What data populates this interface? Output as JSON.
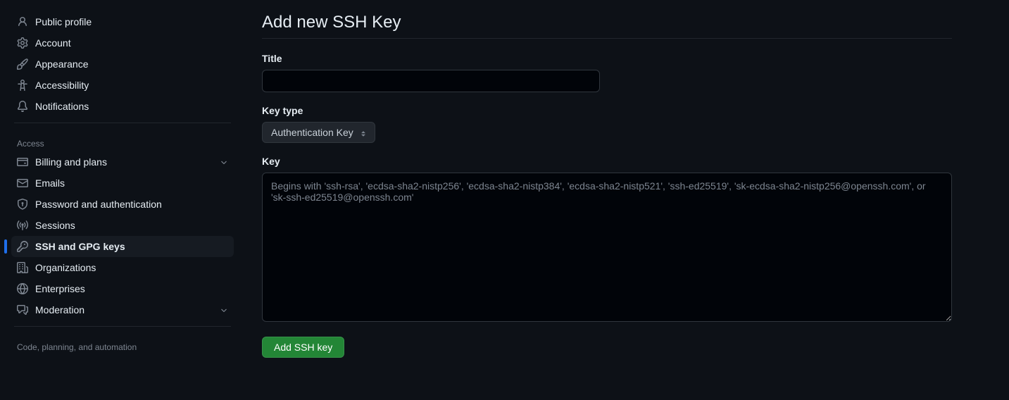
{
  "sidebar": {
    "general": [
      {
        "id": "public-profile",
        "label": "Public profile"
      },
      {
        "id": "account",
        "label": "Account"
      },
      {
        "id": "appearance",
        "label": "Appearance"
      },
      {
        "id": "accessibility",
        "label": "Accessibility"
      },
      {
        "id": "notifications",
        "label": "Notifications"
      }
    ],
    "access_heading": "Access",
    "access": [
      {
        "id": "billing",
        "label": "Billing and plans",
        "expandable": true
      },
      {
        "id": "emails",
        "label": "Emails"
      },
      {
        "id": "password",
        "label": "Password and authentication"
      },
      {
        "id": "sessions",
        "label": "Sessions"
      },
      {
        "id": "ssh",
        "label": "SSH and GPG keys",
        "active": true
      },
      {
        "id": "organizations",
        "label": "Organizations"
      },
      {
        "id": "enterprises",
        "label": "Enterprises"
      },
      {
        "id": "moderation",
        "label": "Moderation",
        "expandable": true
      }
    ],
    "code_heading": "Code, planning, and automation"
  },
  "main": {
    "title": "Add new SSH Key",
    "title_label": "Title",
    "title_value": "",
    "key_type_label": "Key type",
    "key_type_value": "Authentication Key",
    "key_label": "Key",
    "key_placeholder": "Begins with 'ssh-rsa', 'ecdsa-sha2-nistp256', 'ecdsa-sha2-nistp384', 'ecdsa-sha2-nistp521', 'ssh-ed25519', 'sk-ecdsa-sha2-nistp256@openssh.com', or 'sk-ssh-ed25519@openssh.com'",
    "key_value": "",
    "submit_label": "Add SSH key"
  }
}
